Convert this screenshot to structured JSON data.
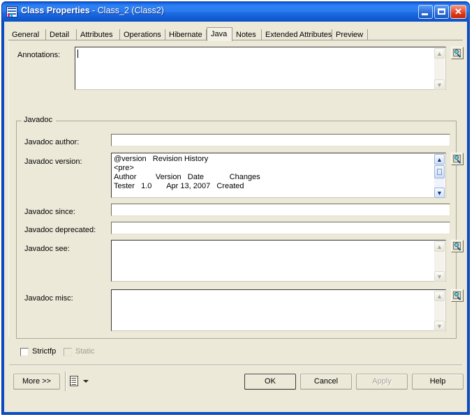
{
  "window": {
    "title_main": "Class Properties",
    "title_sub": " - Class_2 (Class2)",
    "icon": "class-properties-icon",
    "minimize_label": "_",
    "maximize_label": "",
    "close_label": "✕",
    "colors": {
      "titlebar_blue": "#0A56D4",
      "dialog_face": "#ECE9D8",
      "close_red": "#E8553A",
      "border_grey": "#ACA899"
    }
  },
  "tabs": [
    {
      "label": "General",
      "active": false
    },
    {
      "label": "Detail",
      "active": false
    },
    {
      "label": "Attributes",
      "active": false
    },
    {
      "label": "Operations",
      "active": false
    },
    {
      "label": "Hibernate",
      "active": false
    },
    {
      "label": "Java",
      "active": true
    },
    {
      "label": "Notes",
      "active": false
    },
    {
      "label": "Extended Attributes",
      "active": false
    },
    {
      "label": "Preview",
      "active": false
    }
  ],
  "form": {
    "annotations": {
      "label": "Annotations:",
      "value": "",
      "focused": true,
      "scrollbar": "disabled",
      "editor_button": "magnifier-icon"
    },
    "group": {
      "legend": "Javadoc"
    },
    "javadoc_author": {
      "label": "Javadoc author:",
      "value": ""
    },
    "javadoc_version": {
      "label": "Javadoc version:",
      "value": "@version   Revision History\n<pre>\nAuthor         Version   Date            Changes\nTester   1.0       Apr 13, 2007   Created",
      "scrollbar": "enabled",
      "editor_button": "magnifier-icon"
    },
    "javadoc_since": {
      "label": "Javadoc since:",
      "value": ""
    },
    "javadoc_deprecated": {
      "label": "Javadoc deprecated:",
      "value": ""
    },
    "javadoc_see": {
      "label": "Javadoc see:",
      "value": "",
      "scrollbar": "disabled",
      "editor_button": "magnifier-icon"
    },
    "javadoc_misc": {
      "label": "Javadoc misc:",
      "value": "",
      "scrollbar": "disabled",
      "editor_button": "magnifier-icon"
    },
    "strictfp": {
      "label": "Strictfp",
      "checked": false,
      "enabled": true
    },
    "static": {
      "label": "Static",
      "checked": false,
      "enabled": false
    }
  },
  "footer": {
    "more": "More >>",
    "list_icon": "document-list-icon",
    "dropdown_icon": "chevron-down-icon",
    "ok": "OK",
    "cancel": "Cancel",
    "apply": "Apply",
    "help": "Help"
  }
}
